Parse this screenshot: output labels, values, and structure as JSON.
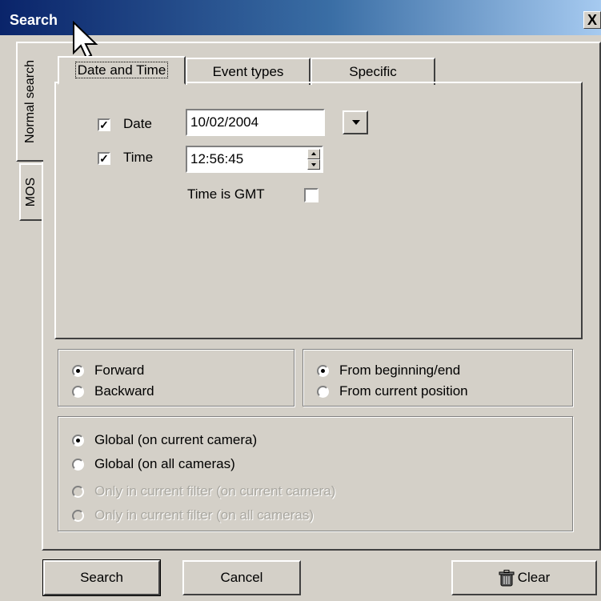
{
  "window": {
    "title": "Search",
    "close_glyph": "X"
  },
  "side_tabs": [
    {
      "label": "Normal search",
      "active": true
    },
    {
      "label": "MOS",
      "active": false
    }
  ],
  "tabs": [
    {
      "label": "Date and Time",
      "active": true
    },
    {
      "label": "Event types",
      "active": false
    },
    {
      "label": "Specific",
      "active": false
    }
  ],
  "datetime": {
    "date_label": "Date",
    "date_checked": true,
    "date_value": "10/02/2004",
    "time_label": "Time",
    "time_checked": true,
    "time_value": "12:56:45",
    "gmt_label": "Time is GMT",
    "gmt_checked": false
  },
  "direction": {
    "forward": "Forward",
    "backward": "Backward",
    "selected": "forward"
  },
  "origin": {
    "from_begin_end": "From beginning/end",
    "from_current": "From current position",
    "selected": "from_begin_end"
  },
  "scope": {
    "global_current": "Global (on current camera)",
    "global_all": "Global (on all cameras)",
    "filter_current": "Only in current filter (on current camera)",
    "filter_all": "Only in current filter (on all cameras)",
    "selected": "global_current"
  },
  "buttons": {
    "search": "Search",
    "cancel": "Cancel",
    "clear": "Clear",
    "clear_icon": "trash-can-icon"
  },
  "colors": {
    "title_gradient_start": "#0a246a",
    "title_gradient_end": "#a6caf0",
    "face": "#d4d0c8"
  }
}
